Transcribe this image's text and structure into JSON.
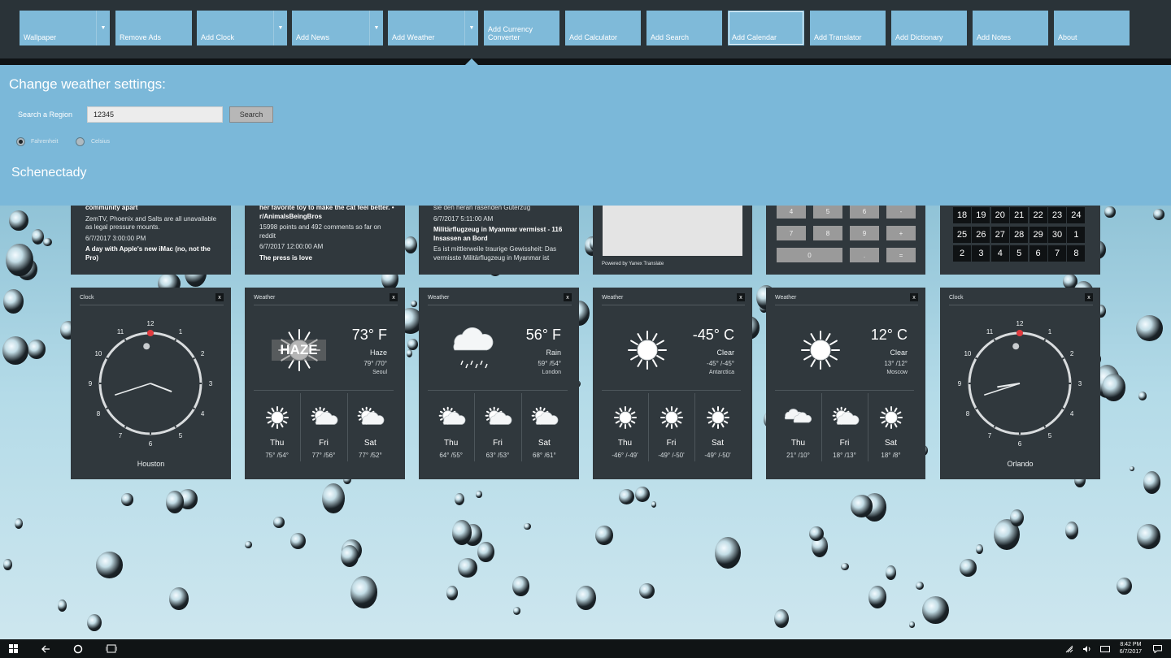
{
  "toolbar": {
    "buttons": [
      {
        "label": "Wallpaper"
      },
      {
        "label": "Remove Ads"
      },
      {
        "label": "Add Clock"
      },
      {
        "label": "Add News"
      },
      {
        "label": "Add Weather"
      },
      {
        "label": "Add Currency Converter"
      },
      {
        "label": "Add Calculator"
      },
      {
        "label": "Add Search"
      },
      {
        "label": "Add Calendar"
      },
      {
        "label": "Add Translator"
      },
      {
        "label": "Add Dictionary"
      },
      {
        "label": "Add Notes"
      },
      {
        "label": "About"
      }
    ],
    "dropdown_glyph": "▼"
  },
  "settings": {
    "title": "Change weather settings:",
    "search_label": "Search a Region",
    "search_value": "12345",
    "search_button": "Search",
    "units": [
      {
        "label": "Fahrenheit",
        "selected": true
      },
      {
        "label": "Celsius",
        "selected": false
      }
    ],
    "region": "Schenectady"
  },
  "news": [
    {
      "items": [
        {
          "text": "community apart",
          "bold": true
        },
        {
          "text": "ZemTV, Phoenix and Salts are all unavailable as legal pressure mounts.",
          "bold": false
        },
        {
          "text": "6/7/2017 3:00:00 PM",
          "bold": false
        },
        {
          "text": "A day with Apple's new iMac (no, not the Pro)",
          "bold": true
        }
      ]
    },
    {
      "items": [
        {
          "text": "her favorite toy to make the cat feel better. • r/AnimalsBeingBros",
          "bold": true
        },
        {
          "text": "15998 points and 492 comments so far on reddit",
          "bold": false
        },
        {
          "text": "6/7/2017 12:00:00 AM",
          "bold": false
        },
        {
          "text": "The press is love",
          "bold": true
        }
      ]
    },
    {
      "items": [
        {
          "text": "sie den heran rasenden Güterzug",
          "bold": false
        },
        {
          "text": "6/7/2017 5:11:00 AM",
          "bold": false
        },
        {
          "text": "Militärflugzeug in Myanmar vermisst - 116 Insassen an Bord",
          "bold": true
        },
        {
          "text": "Es ist mittlerweile traurige Gewissheit: Das vermisste Militärflugzeug in Myanmar ist",
          "bold": false
        }
      ]
    }
  ],
  "translator": {
    "powered_by": "Powered by Yanex Translate"
  },
  "calculator": {
    "rows": [
      [
        "4",
        "5",
        "6",
        "-"
      ],
      [
        "7",
        "8",
        "9",
        "+"
      ],
      [
        "0",
        ".",
        "="
      ]
    ]
  },
  "calendar": {
    "rows": [
      [
        "18",
        "19",
        "20",
        "21",
        "22",
        "23",
        "24"
      ],
      [
        "25",
        "26",
        "27",
        "28",
        "29",
        "30",
        "1"
      ],
      [
        "2",
        "3",
        "4",
        "5",
        "6",
        "7",
        "8"
      ]
    ]
  },
  "clocks": [
    {
      "title": "Clock",
      "city": "Houston",
      "close": "x",
      "hour": 3,
      "minute": 42,
      "second": 59
    },
    {
      "title": "Clock",
      "city": "Orlando",
      "close": "x",
      "hour": 8,
      "minute": 42,
      "second": 59
    }
  ],
  "clock_numbers": [
    "12",
    "1",
    "2",
    "3",
    "4",
    "5",
    "6",
    "7",
    "8",
    "9",
    "10",
    "11"
  ],
  "weather": [
    {
      "title": "Weather",
      "close": "x",
      "temp": "73° F",
      "condition": "Haze",
      "hilo": "79° /70°",
      "city": "Seoul",
      "icon": "haze-icon",
      "haze_label": "HAZE",
      "forecast": [
        {
          "day": "Thu",
          "temps": "75° /54°",
          "icon": "sun-icon"
        },
        {
          "day": "Fri",
          "temps": "77° /56°",
          "icon": "partly-cloudy-icon"
        },
        {
          "day": "Sat",
          "temps": "77° /52°",
          "icon": "partly-cloudy-icon"
        }
      ]
    },
    {
      "title": "Weather",
      "close": "x",
      "temp": "56° F",
      "condition": "Rain",
      "hilo": "59° /54°",
      "city": "London",
      "icon": "rain-icon",
      "forecast": [
        {
          "day": "Thu",
          "temps": "64° /55°",
          "icon": "partly-cloudy-icon"
        },
        {
          "day": "Fri",
          "temps": "63° /53°",
          "icon": "partly-cloudy-icon"
        },
        {
          "day": "Sat",
          "temps": "68° /61°",
          "icon": "partly-cloudy-icon"
        }
      ]
    },
    {
      "title": "Weather",
      "close": "x",
      "temp": "-45° C",
      "condition": "Clear",
      "hilo": "-45° /-45°",
      "city": "Antarctica",
      "icon": "sun-icon",
      "forecast": [
        {
          "day": "Thu",
          "temps": "-46° /-49'",
          "icon": "sun-icon"
        },
        {
          "day": "Fri",
          "temps": "-49° /-50'",
          "icon": "sun-icon"
        },
        {
          "day": "Sat",
          "temps": "-49° /-50'",
          "icon": "sun-icon"
        }
      ]
    },
    {
      "title": "Weather",
      "close": "x",
      "temp": "12° C",
      "condition": "Clear",
      "hilo": "13° /12°",
      "city": "Moscow",
      "icon": "sun-icon",
      "forecast": [
        {
          "day": "Thu",
          "temps": "21° /10°",
          "icon": "cloudy-icon"
        },
        {
          "day": "Fri",
          "temps": "18° /13°",
          "icon": "partly-cloudy-icon"
        },
        {
          "day": "Sat",
          "temps": "18° /8°",
          "icon": "sun-icon"
        }
      ]
    }
  ],
  "taskbar": {
    "time": "8:42 PM",
    "date": "6/7/2017"
  },
  "colors": {
    "accent": "#7fbad9",
    "panel": "#7bb8d9",
    "card": "#30383d",
    "clock_second_hand": "#e03a3e"
  }
}
